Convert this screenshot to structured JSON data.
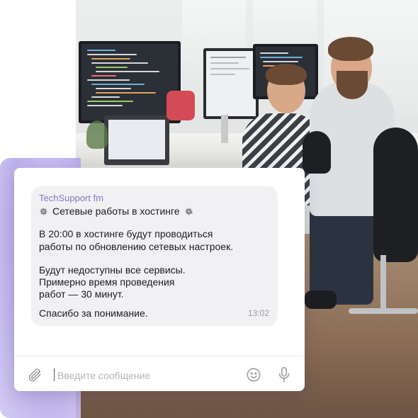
{
  "message": {
    "sender": "TechSupport fm",
    "title": "Сетевые работы в хостинге",
    "body_lines": [
      "В 20:00 в хостинге будут проводиться",
      "работы по обновлению сетевых настроек.",
      "Будут недоступны все сервисы.",
      "Примерно время проведения",
      "работ — 30 минут.",
      "Спасибо за понимание."
    ],
    "time": "13:02",
    "title_icon": "gear-icon"
  },
  "composer": {
    "placeholder": "Введите сообщение",
    "value": "",
    "attach_icon": "paperclip-icon",
    "emoji_icon": "smiley-icon",
    "mic_icon": "microphone-icon"
  },
  "colors": {
    "accent": "#8b74c9",
    "accent_background": "#b6a9ea",
    "bubble": "#f1f1f3",
    "icon": "#9a9aa3"
  }
}
